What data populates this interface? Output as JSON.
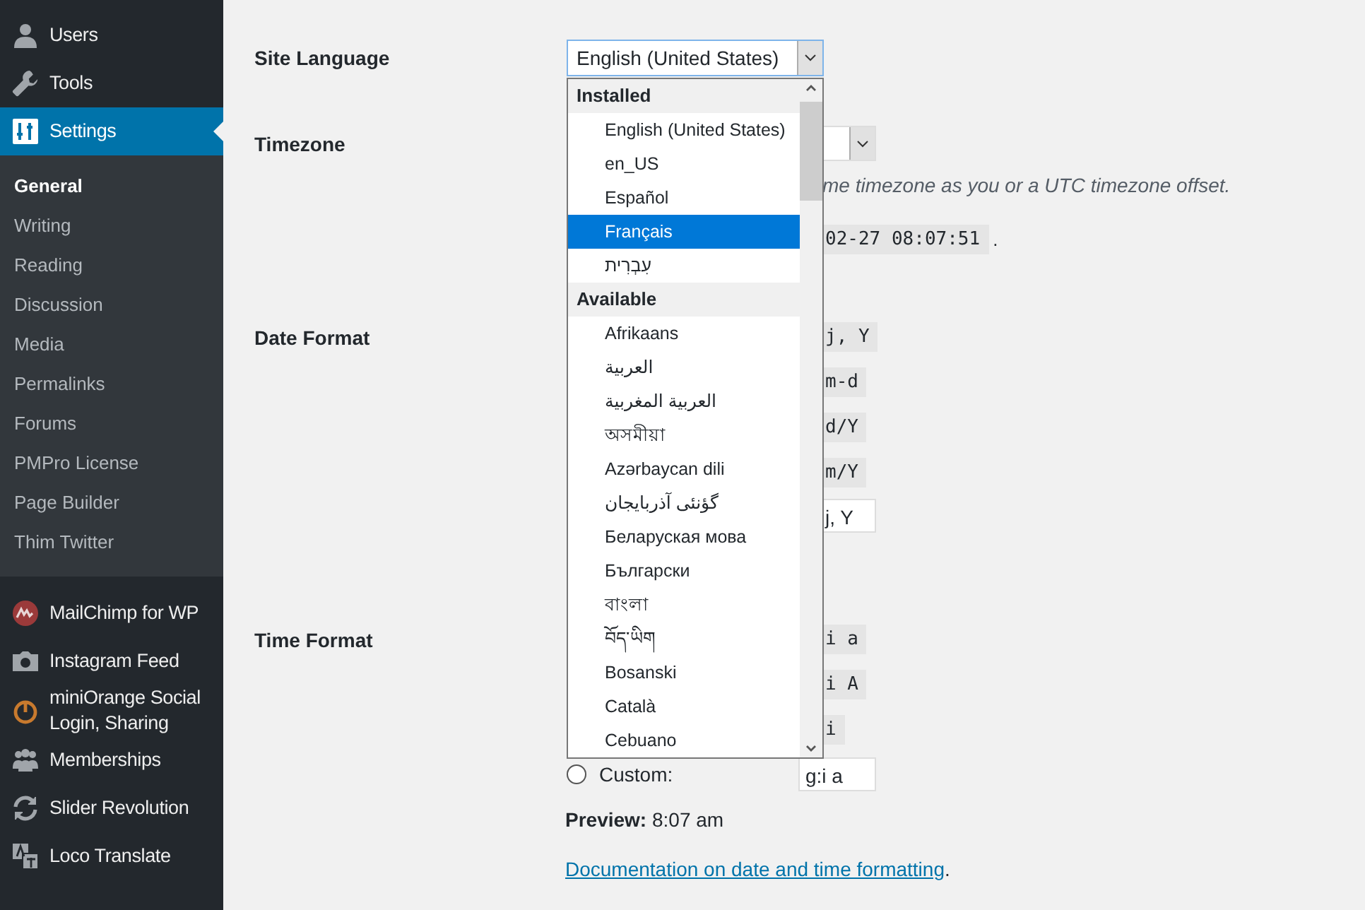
{
  "sidebar": {
    "items": [
      {
        "label": "Users",
        "selected": false
      },
      {
        "label": "Tools",
        "selected": false
      },
      {
        "label": "Settings",
        "selected": true,
        "children": [
          {
            "label": "General",
            "selected": true
          },
          {
            "label": "Writing",
            "selected": false
          },
          {
            "label": "Reading",
            "selected": false
          },
          {
            "label": "Discussion",
            "selected": false
          },
          {
            "label": "Media",
            "selected": false
          },
          {
            "label": "Permalinks",
            "selected": false
          },
          {
            "label": "Forums",
            "selected": false
          },
          {
            "label": "PMPro License",
            "selected": false
          },
          {
            "label": "Page Builder",
            "selected": false
          },
          {
            "label": "Thim Twitter",
            "selected": false
          }
        ]
      },
      {
        "label": "MailChimp for WP",
        "selected": false
      },
      {
        "label": "Instagram Feed",
        "selected": false
      },
      {
        "label": "miniOrange Social Login, Sharing",
        "selected": false
      },
      {
        "label": "Memberships",
        "selected": false
      },
      {
        "label": "Slider Revolution",
        "selected": false
      },
      {
        "label": "Loco Translate",
        "selected": false
      }
    ]
  },
  "site_language": {
    "label": "Site Language",
    "value": "English (United States)",
    "dropdown": {
      "groups": [
        {
          "label": "Installed",
          "options": [
            {
              "label": "English (United States)",
              "selected": false
            },
            {
              "label": "en_US",
              "selected": false
            },
            {
              "label": "Español",
              "selected": false
            },
            {
              "label": "Français",
              "selected": true
            },
            {
              "label": "עִבְרִית",
              "selected": false
            }
          ]
        },
        {
          "label": "Available",
          "options": [
            {
              "label": "Afrikaans",
              "selected": false
            },
            {
              "label": "العربية",
              "selected": false
            },
            {
              "label": "العربية المغربية",
              "selected": false
            },
            {
              "label": "অসমীয়া",
              "selected": false
            },
            {
              "label": "Azərbaycan dili",
              "selected": false
            },
            {
              "label": "گؤنئی آذربایجان",
              "selected": false
            },
            {
              "label": "Беларуская мова",
              "selected": false
            },
            {
              "label": "Български",
              "selected": false
            },
            {
              "label": "বাংলা",
              "selected": false
            },
            {
              "label": "བོད་ཡིག",
              "selected": false
            },
            {
              "label": "Bosanski",
              "selected": false
            },
            {
              "label": "Català",
              "selected": false
            },
            {
              "label": "Cebuano",
              "selected": false
            }
          ]
        }
      ]
    }
  },
  "timezone": {
    "label": "Timezone",
    "description": "me timezone as you or a UTC timezone offset.",
    "time": "02-27 08:07:51",
    "time_suffix": "."
  },
  "date_format": {
    "label": "Date Format",
    "options": [
      {
        "code": "j, Y"
      },
      {
        "code": "m-d"
      },
      {
        "code": "d/Y"
      },
      {
        "code": "m/Y"
      }
    ],
    "custom_value": "j, Y"
  },
  "time_format": {
    "label": "Time Format",
    "options": [
      {
        "code": "i a"
      },
      {
        "code": "i A"
      },
      {
        "code": "i"
      }
    ],
    "custom": {
      "label": "Custom:",
      "value": "g:i a",
      "selected": false
    }
  },
  "preview": "**Preview:** 8:07 am",
  "help": {
    "link": "Documentation on date and time formatting",
    "suffix": "."
  }
}
